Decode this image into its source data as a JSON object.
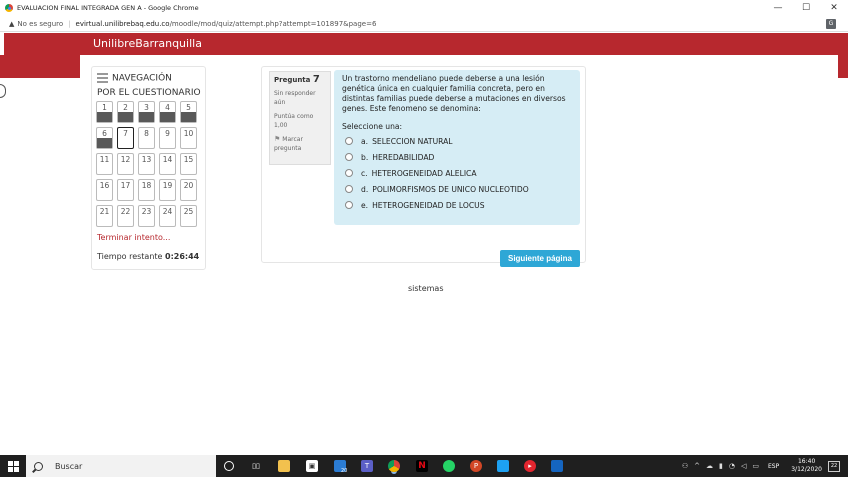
{
  "window": {
    "title": "EVALUACION FINAL INTEGRADA GEN A - Google Chrome",
    "minimize": "—",
    "maximize": "☐",
    "close": "✕"
  },
  "address": {
    "warning_icon": "warning-triangle-icon",
    "insecure_label": "No es seguro",
    "separator": "|",
    "domain": "evirtual.unilibrebaq.edu.co",
    "path": "/moodle/mod/quiz/attempt.php?attempt=101897&page=6",
    "translate": "G"
  },
  "header": {
    "brand": "UnilibreBarranquilla"
  },
  "navigation": {
    "title_line1": "NAVEGACIÓN",
    "title_line2": "POR EL CUESTIONARIO",
    "questions": [
      {
        "num": "1",
        "answered": true
      },
      {
        "num": "2",
        "answered": true
      },
      {
        "num": "3",
        "answered": true
      },
      {
        "num": "4",
        "answered": true
      },
      {
        "num": "5",
        "answered": true
      },
      {
        "num": "6",
        "answered": true
      },
      {
        "num": "7",
        "answered": false,
        "current": true
      },
      {
        "num": "8",
        "answered": false
      },
      {
        "num": "9",
        "answered": false
      },
      {
        "num": "10",
        "answered": false
      },
      {
        "num": "11",
        "answered": false
      },
      {
        "num": "12",
        "answered": false
      },
      {
        "num": "13",
        "answered": false
      },
      {
        "num": "14",
        "answered": false
      },
      {
        "num": "15",
        "answered": false
      },
      {
        "num": "16",
        "answered": false
      },
      {
        "num": "17",
        "answered": false
      },
      {
        "num": "18",
        "answered": false
      },
      {
        "num": "19",
        "answered": false
      },
      {
        "num": "20",
        "answered": false
      },
      {
        "num": "21",
        "answered": false
      },
      {
        "num": "22",
        "answered": false
      },
      {
        "num": "23",
        "answered": false
      },
      {
        "num": "24",
        "answered": false
      },
      {
        "num": "25",
        "answered": false
      }
    ],
    "finish_link": "Terminar intento...",
    "time_label": "Tiempo restante",
    "time_value": "0:26:44"
  },
  "question": {
    "label": "Pregunta",
    "number": "7",
    "state": "Sin responder aún",
    "grade": "Puntúa como 1,00",
    "flag_label": "Marcar pregunta",
    "text": "Un trastorno mendeliano puede deberse a una lesión genética única en cualquier familia concreta, pero en distintas familias puede deberse a mutaciones en diversos genes. Este fenomeno se denomina:",
    "prompt": "Seleccione una:",
    "options": [
      {
        "letter": "a.",
        "text": "SELECCION NATURAL"
      },
      {
        "letter": "b.",
        "text": "HEREDABILIDAD"
      },
      {
        "letter": "c.",
        "text": "HETEROGENEIDAD ALELICA"
      },
      {
        "letter": "d.",
        "text": "POLIMORFISMOS DE UNICO NUCLEOTIDO"
      },
      {
        "letter": "e.",
        "text": "HETEROGENEIDAD DE LOCUS"
      }
    ],
    "next_button": "Siguiente página"
  },
  "footer": {
    "text": "sistemas"
  },
  "taskbar": {
    "search_placeholder": "Buscar",
    "mail_badge": "20",
    "tray_lang": "ESP",
    "time": "16:40",
    "date": "3/12/2020",
    "notifications": "22"
  }
}
